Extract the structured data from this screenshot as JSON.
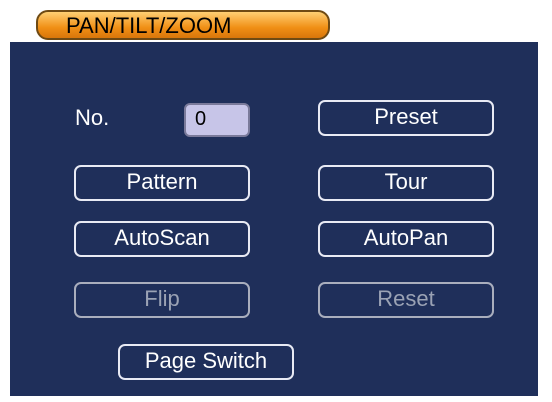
{
  "dialog": {
    "title": "PAN/TILT/ZOOM"
  },
  "no_field": {
    "label": "No.",
    "value": "0"
  },
  "buttons": {
    "preset": "Preset",
    "pattern": "Pattern",
    "tour": "Tour",
    "autoscan": "AutoScan",
    "autopan": "AutoPan",
    "flip": "Flip",
    "reset": "Reset",
    "page_switch": "Page Switch"
  },
  "colors": {
    "background": "#1f2f5a",
    "tab_orange": "#f08f15",
    "input_fill": "#c7c5e8"
  }
}
